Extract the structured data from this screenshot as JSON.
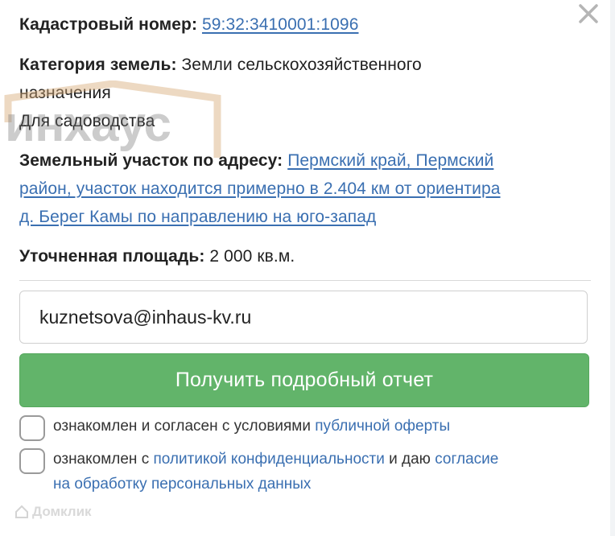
{
  "close_icon": "close-icon",
  "cadastral": {
    "label": "Кадастровый номер:",
    "value": "59:32:3410001:1096"
  },
  "land_category": {
    "label": "Категория земель:",
    "value_line1": "Земли сельскохозяйственного",
    "value_line2": "назначения"
  },
  "permitted_use": "Для садоводства",
  "address": {
    "label": "Земельный участок по адресу:",
    "line1": "Пермский край, Пермский",
    "line2": "район, участок находится примерно в 2.404 км от ориентира",
    "line3": "д. Берег Камы по направлению на юго-запад"
  },
  "area": {
    "label": "Уточненная площадь:",
    "value": "2 000 кв.м."
  },
  "email_field": {
    "value": "kuznetsova@inhaus-kv.ru"
  },
  "submit_label": "Получить подробный отчет",
  "consent1": {
    "text": "ознакомлен и согласен с условиями ",
    "link": "публичной оферты"
  },
  "consent2": {
    "text1": "ознакомлен с ",
    "link1": "политикой конфиденциальности",
    "text2": " и даю ",
    "link2_line1": "согласие",
    "link2_line2": "на обработку персональных данных"
  },
  "watermark": {
    "brand": "инхаус",
    "footer": "Домклик"
  },
  "colors": {
    "link": "#3a6fb1",
    "button": "#62b46a",
    "watermark": "#8a8a8a"
  }
}
